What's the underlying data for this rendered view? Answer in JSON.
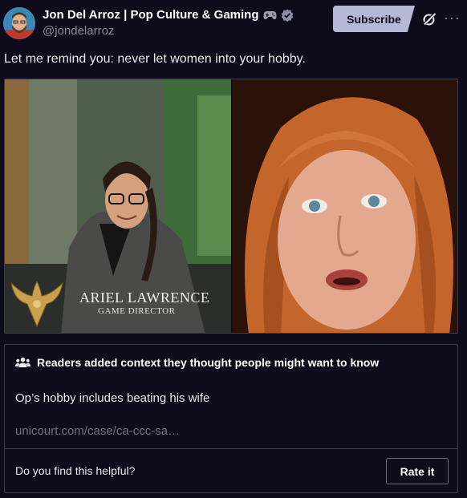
{
  "author": {
    "display_name": "Jon Del Arroz | Pop Culture & Gaming",
    "handle": "@jondelarroz",
    "avatar_icon": "bearded-man-cartoon-avatar",
    "badges": [
      "game-controller-icon",
      "verified-check-icon"
    ]
  },
  "header": {
    "subscribe_label": "Subscribe",
    "grok_icon": "grok-icon",
    "more_icon": "more-horizontal-icon",
    "more_glyph": "···"
  },
  "tweet": {
    "text": "Let me remind you: never let women into your hobby."
  },
  "media": {
    "left_photo": {
      "nameplate_name": "ARIEL LAWRENCE",
      "nameplate_title": "GAME DIRECTOR"
    }
  },
  "community_note": {
    "header": "Readers added context they thought people might want to know",
    "body": "Op’s hobby includes beating his wife",
    "link": "unicourt.com/case/ca-ccc-sa…",
    "helpful_prompt": "Do you find this helpful?",
    "rate_label": "Rate it"
  },
  "colors": {
    "background": "#0e0b1a",
    "subscribe_bg": "#b3b9d6",
    "border": "#3a3d4e",
    "muted_text": "#8b8d96"
  }
}
